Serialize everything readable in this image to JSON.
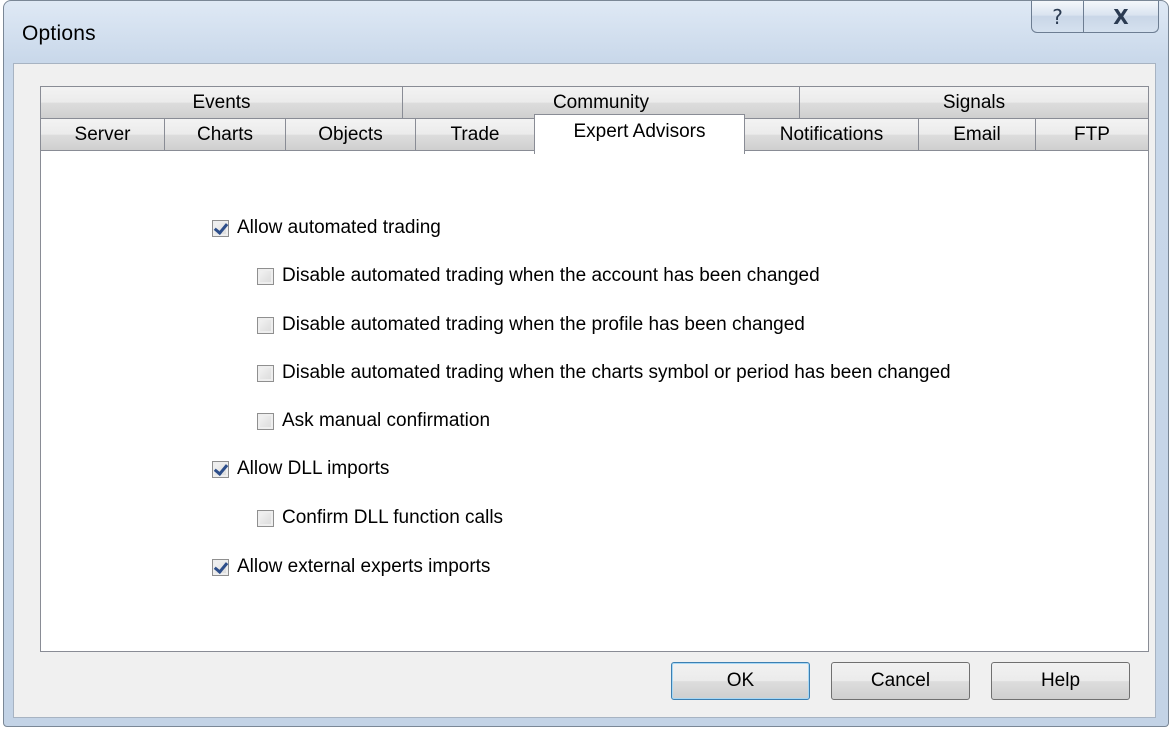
{
  "window": {
    "title": "Options",
    "help_glyph": "?",
    "close_glyph": "X"
  },
  "tabs": {
    "back_row": [
      {
        "label": "Events"
      },
      {
        "label": "Community"
      },
      {
        "label": "Signals"
      }
    ],
    "front_row": [
      {
        "label": "Server"
      },
      {
        "label": "Charts"
      },
      {
        "label": "Objects"
      },
      {
        "label": "Trade"
      },
      {
        "label": "Expert Advisors",
        "active": true
      },
      {
        "label": "Notifications"
      },
      {
        "label": "Email"
      },
      {
        "label": "FTP"
      }
    ]
  },
  "options": [
    {
      "label": "Allow automated trading",
      "checked": true
    },
    {
      "label": "Disable automated trading when the account has been changed",
      "checked": false
    },
    {
      "label": "Disable automated trading when the profile has been changed",
      "checked": false
    },
    {
      "label": "Disable automated trading when the charts symbol or period has been changed",
      "checked": false
    },
    {
      "label": "Ask manual confirmation",
      "checked": false
    },
    {
      "label": "Allow DLL imports",
      "checked": true
    },
    {
      "label": "Confirm DLL function calls",
      "checked": false
    },
    {
      "label": "Allow external experts imports",
      "checked": true
    }
  ],
  "buttons": {
    "ok": "OK",
    "cancel": "Cancel",
    "help": "Help"
  }
}
